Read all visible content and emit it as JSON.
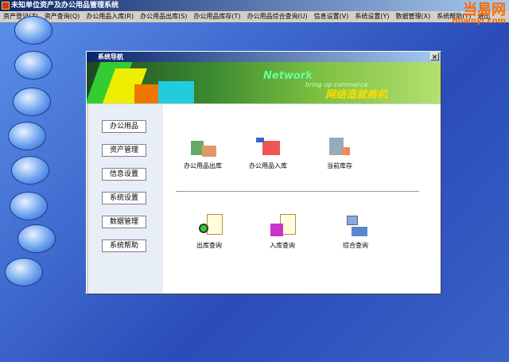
{
  "app": {
    "title": "未知单位资产及办公用品管理系统"
  },
  "menu": [
    "资产登记(Z)",
    "资产查询(Q)",
    "办公用品入库(R)",
    "办公用品出库(S)",
    "办公用品库存(T)",
    "办公用品综合查询(U)",
    "信息设置(V)",
    "系统设置(Y)",
    "数据管理(X)",
    "系统帮助(T)",
    "退出"
  ],
  "watermark": {
    "line1": "当易网",
    "line2": "downyi.com"
  },
  "dialog": {
    "title": "系统导航",
    "close": "×",
    "banner": {
      "line1": "Network",
      "line2": "bring up commerce",
      "line3": "网络造就商机"
    },
    "nav": [
      "办公用品",
      "资产管理",
      "信息设置",
      "系统设置",
      "数据管理",
      "系统帮助"
    ],
    "actions": [
      "办公用品出库",
      "办公用品入库",
      "当前库存",
      "出库查询",
      "入库查询",
      "综合查询"
    ]
  }
}
